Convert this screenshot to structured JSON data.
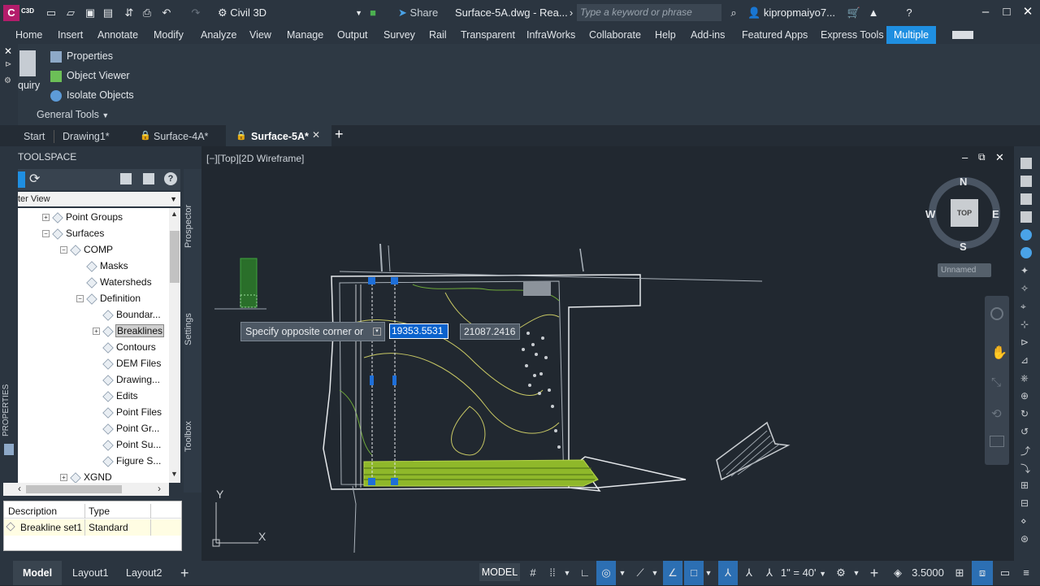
{
  "app": {
    "icon_text": "C",
    "icon_sub": "C3D",
    "workspace": "Civil 3D",
    "share_label": "Share",
    "doc_title": "Surface-5A.dwg - Rea...",
    "search_placeholder": "Type a keyword or phrase",
    "user": "kipropmaiyo7..."
  },
  "ribbon_tabs": [
    "Home",
    "Insert",
    "Annotate",
    "Modify",
    "Analyze",
    "View",
    "Manage",
    "Output",
    "Survey",
    "Rail",
    "Transparent",
    "InfraWorks",
    "Collaborate",
    "Help",
    "Add-ins",
    "Featured Apps",
    "Express Tools",
    "Multiple"
  ],
  "active_ribbon_tab": "Multiple",
  "ribbon": {
    "inquiry_label": "quiry",
    "items": [
      "Properties",
      "Object Viewer",
      "Isolate Objects"
    ],
    "panel_title": "General Tools"
  },
  "doc_tabs": [
    "Start",
    "Drawing1*",
    "Surface-4A*",
    "Surface-5A*"
  ],
  "active_doc_tab": "Surface-5A*",
  "toolspace": {
    "title": "TOOLSPACE",
    "view": "ter View",
    "tree": [
      {
        "label": "Point Groups",
        "level": 1,
        "expander": "+"
      },
      {
        "label": "Surfaces",
        "level": 1,
        "expander": "-"
      },
      {
        "label": "COMP",
        "level": 2,
        "expander": "-"
      },
      {
        "label": "Masks",
        "level": 3,
        "expander": ""
      },
      {
        "label": "Watersheds",
        "level": 3,
        "expander": ""
      },
      {
        "label": "Definition",
        "level": 3,
        "expander": "-"
      },
      {
        "label": "Boundar...",
        "level": 4,
        "expander": ""
      },
      {
        "label": "Breaklines",
        "level": 4,
        "expander": "+",
        "selected": true
      },
      {
        "label": "Contours",
        "level": 4,
        "expander": ""
      },
      {
        "label": "DEM Files",
        "level": 4,
        "expander": ""
      },
      {
        "label": "Drawing...",
        "level": 4,
        "expander": ""
      },
      {
        "label": "Edits",
        "level": 4,
        "expander": ""
      },
      {
        "label": "Point Files",
        "level": 4,
        "expander": ""
      },
      {
        "label": "Point Gr...",
        "level": 4,
        "expander": ""
      },
      {
        "label": "Point Su...",
        "level": 4,
        "expander": ""
      },
      {
        "label": "Figure S...",
        "level": 4,
        "expander": ""
      },
      {
        "label": "XGND",
        "level": 2,
        "expander": "+"
      }
    ],
    "side_tabs": [
      "Prospector",
      "Settings",
      "Toolbox"
    ],
    "properties_label": "PROPERTIES",
    "table": {
      "headers": [
        "Description",
        "Type"
      ],
      "rows": [
        [
          "Breakline set1",
          "Standard"
        ]
      ]
    }
  },
  "viewport": {
    "label": "[−][Top][2D Wireframe]",
    "tooltip": "Specify opposite corner or",
    "input_x": "19353.5531",
    "input_y": "21087.2416",
    "compass": {
      "n": "N",
      "s": "S",
      "e": "E",
      "w": "W",
      "top": "TOP"
    },
    "ucs_name": "Unnamed",
    "ucs_x": "X",
    "ucs_y": "Y"
  },
  "status": {
    "layout_tabs": [
      "Model",
      "Layout1",
      "Layout2"
    ],
    "active_layout": "Model",
    "model_button": "MODEL",
    "scale": "1\" = 40'",
    "lineweight": "3.5000"
  },
  "colors": {
    "accent": "#1f8fe1",
    "terrain_green": "#9acd32",
    "contour_yellow": "#c8c864",
    "selection_blue": "#1e6fd9"
  }
}
